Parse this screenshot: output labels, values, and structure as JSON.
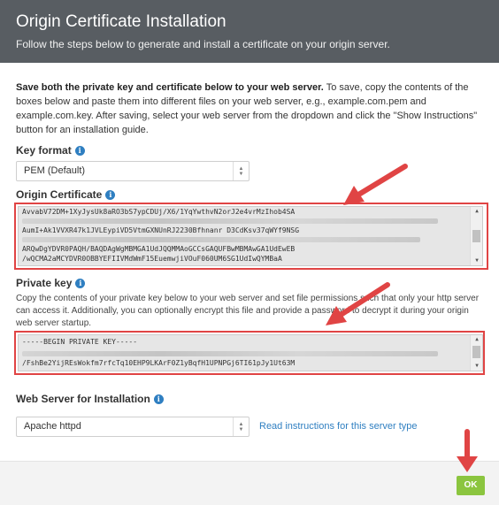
{
  "header": {
    "title": "Origin Certificate Installation",
    "subtitle": "Follow the steps below to generate and install a certificate on your origin server."
  },
  "intro": {
    "bold": "Save both the private key and certificate below to your web server.",
    "rest": " To save, copy the contents of the boxes below and paste them into different files on your web server, e.g., example.com.pem and example.com.key. After saving, select your web server from the dropdown and click the \"Show Instructions\" button for an installation guide."
  },
  "key_format": {
    "label": "Key format",
    "value": "PEM (Default)"
  },
  "origin_certificate": {
    "label": "Origin Certificate",
    "lines": [
      "AvvabV72DM+1XyJysUk8aRO3bS7ypCDUj/X6/1YqYwthvN2orJ2e4vrMzIhob4SA",
      "",
      "AumI+Ak1VVXR47k1JVLEypiVD5VtmGXNUnRJ2230Bfhnanr D3CdKsv37qWYf9NSG",
      "",
      "ARQwDgYDVR0PAQH/BAQDAgWgMBMGA1UdJQQMMAoGCCsGAQUFBwMBMAwGA1UdEwEB",
      "/wQCMA2aMCYDVR0OBBYEFIIVMdWmF15EuemwjiVOuF060UM6SG1UdIwQYMBaA"
    ]
  },
  "private_key": {
    "label": "Private key",
    "description": "Copy the contents of your private key below to your web server and set file permissions such that only your http server can access it. Additionally, you can optionally encrypt this file and provide a password to decrypt it during your origin web server startup.",
    "lines": [
      "-----BEGIN PRIVATE KEY-----",
      "",
      "/FshBe2YijREsWokfm7rfcTq10EHP9LKArF0Z1yBqfH1UPNPGj6TI61pJy1Ut63M"
    ]
  },
  "web_server": {
    "label": "Web Server for Installation",
    "value": "Apache httpd",
    "instructions_link": "Read instructions for this server type"
  },
  "footer": {
    "ok_label": "OK"
  },
  "colors": {
    "header_bg": "#585d62",
    "highlight": "#e04444",
    "ok_button": "#8bc53f",
    "link": "#2f7fc1"
  }
}
